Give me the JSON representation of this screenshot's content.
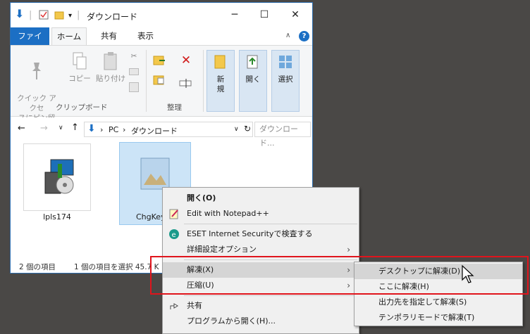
{
  "window": {
    "title": "ダウンロード",
    "min_glyph": "─",
    "max_glyph": "☐",
    "close_glyph": "✕"
  },
  "tabs": [
    {
      "label": "ファイル"
    },
    {
      "label": "ホーム"
    },
    {
      "label": "共有"
    },
    {
      "label": "表示"
    }
  ],
  "ribbon": {
    "pin": "クイック アクセ\nスにピン留め",
    "copy": "コピー",
    "paste": "貼り付け",
    "clipboard_group": "クリップボード",
    "organize_group": "整理",
    "new": "新\n規",
    "open": "開く",
    "select": "選択"
  },
  "address": {
    "path_pc": "PC",
    "path_sep": "›",
    "path_folder": "ダウンロード",
    "search_placeholder": "ダウンロード..."
  },
  "files": [
    {
      "name": "lpls174"
    },
    {
      "name": "ChgKey"
    }
  ],
  "status": {
    "count": "2 個の項目",
    "selected": "1 個の項目を選択  45.7 K"
  },
  "context_menu": [
    {
      "label": "開く(O)",
      "bold": true
    },
    {
      "label": "Edit with Notepad++"
    },
    {
      "label": "ESET Internet Securityで検査する"
    },
    {
      "label": "詳細設定オプション",
      "submenu": true
    },
    {
      "label": "解凍(X)",
      "submenu": true,
      "highlighted": true
    },
    {
      "label": "圧縮(U)",
      "submenu": true
    },
    {
      "label": "共有"
    },
    {
      "label": "プログラムから開く(H)..."
    }
  ],
  "submenu": [
    {
      "label": "デスクトップに解凍(D)",
      "highlighted": true
    },
    {
      "label": "ここに解凍(H)"
    },
    {
      "label": "出力先を指定して解凍(S)"
    },
    {
      "label": "テンポラリモードで解凍(T)"
    }
  ],
  "colors": {
    "accent": "#1c6fc4",
    "highlight_box": "#e0141c"
  }
}
